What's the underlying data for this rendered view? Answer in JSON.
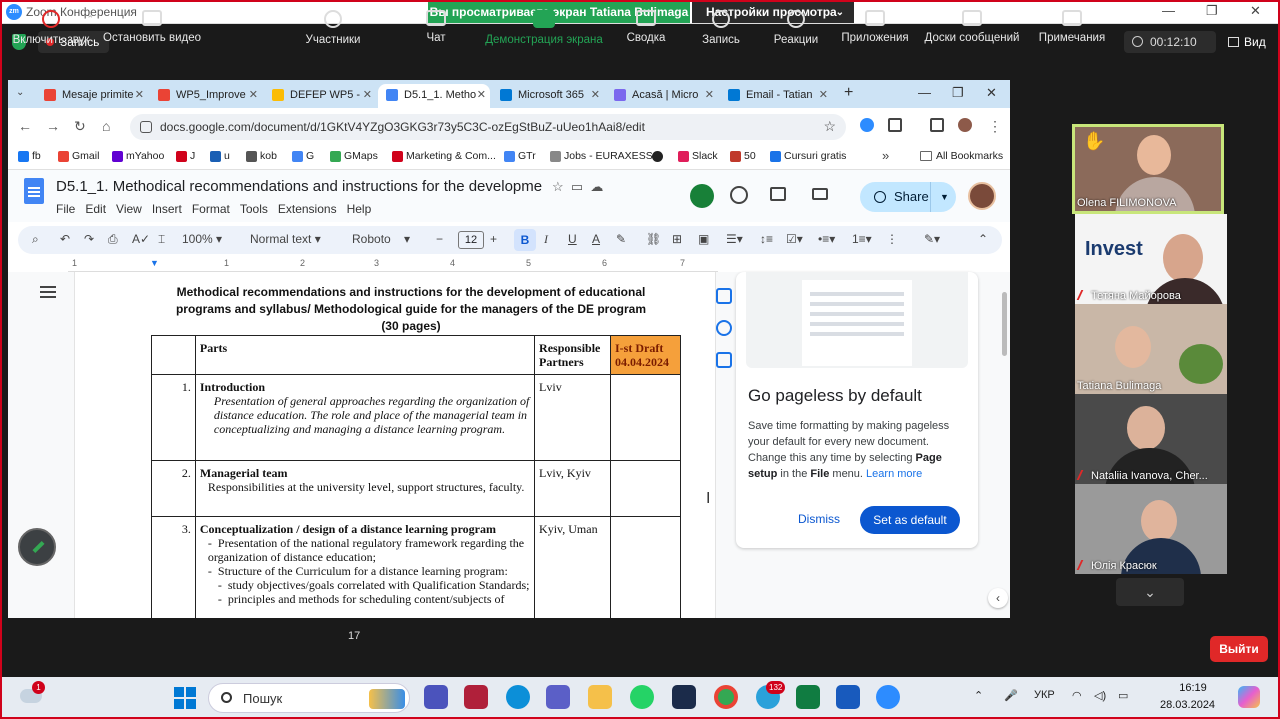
{
  "zoom": {
    "app_title": "Zoom Конференция",
    "viewing_banner": "Вы просматриваете экран Tatiana Bulimaga",
    "view_settings": "Настройки просмотра",
    "recording_label": "Запись",
    "timer": "00:12:10",
    "view_label": "Вид",
    "leave_label": "Выйти",
    "participants_count": "17",
    "toolbar": [
      {
        "name": "unmute",
        "label": "Включить звук"
      },
      {
        "name": "start-video",
        "label": "Остановить видео"
      },
      {
        "name": "participants",
        "label": "Участники"
      },
      {
        "name": "chat",
        "label": "Чат"
      },
      {
        "name": "share-screen",
        "label": "Демонстрация экрана"
      },
      {
        "name": "summary",
        "label": "Сводка"
      },
      {
        "name": "record",
        "label": "Запись"
      },
      {
        "name": "reactions",
        "label": "Реакции"
      },
      {
        "name": "apps",
        "label": "Приложения"
      },
      {
        "name": "whiteboards",
        "label": "Доски сообщений"
      },
      {
        "name": "notes",
        "label": "Примечания"
      }
    ],
    "participants": [
      {
        "name": "Olena FILIMONOVA",
        "muted": false
      },
      {
        "name": "Тетяна Майорова",
        "muted": true
      },
      {
        "name": "Tatiana Bulimaga",
        "muted": false
      },
      {
        "name": "Nataliia Ivanova, Cher...",
        "muted": true
      },
      {
        "name": "Юлія Красюк",
        "muted": true
      }
    ]
  },
  "chrome": {
    "tabs": [
      {
        "label": "Mesaje primite",
        "color": "#ea4335"
      },
      {
        "label": "WP5_Improve",
        "color": "#ea4335"
      },
      {
        "label": "DEFEP WP5 -",
        "color": "#fbbc04"
      },
      {
        "label": "D5.1_1. Metho",
        "color": "#4285f4"
      },
      {
        "label": "Microsoft 365",
        "color": "#0078d4"
      },
      {
        "label": "Acasă | Micro",
        "color": "#7b68ee"
      },
      {
        "label": "Email - Tatian",
        "color": "#0078d4"
      }
    ],
    "url": "docs.google.com/document/d/1GKtV4YZgO3GKG3r73y5C3C-ozEgStBuZ-uUeo1hAai8/edit",
    "bookmarks": [
      {
        "label": "fb",
        "color": "#1877f2"
      },
      {
        "label": "Gmail",
        "color": "#ea4335"
      },
      {
        "label": "mYahoo",
        "color": "#6001d2"
      },
      {
        "label": "J",
        "color": "#d0021b"
      },
      {
        "label": "u",
        "color": "#1a5fb4"
      },
      {
        "label": "kob",
        "color": "#555555"
      },
      {
        "label": "G",
        "color": "#4285f4"
      },
      {
        "label": "GMaps",
        "color": "#34a853"
      },
      {
        "label": "Marketing & Com...",
        "color": "#d0021b"
      },
      {
        "label": "GTr",
        "color": "#4285f4"
      },
      {
        "label": "Jobs - EURAXESS",
        "color": "#888888"
      },
      {
        "label": "",
        "color": "#222222"
      },
      {
        "label": "Slack",
        "color": "#e01e5a"
      },
      {
        "label": "50",
        "color": "#c0392b"
      },
      {
        "label": "Cursuri gratis",
        "color": "#1a73e8"
      }
    ],
    "all_bookmarks": "All Bookmarks"
  },
  "docs": {
    "title": "D5.1_1. Methodical recommendations and instructions for the developmen...",
    "menu": [
      "File",
      "Edit",
      "View",
      "Insert",
      "Format",
      "Tools",
      "Extensions",
      "Help"
    ],
    "share_label": "Share",
    "zoom": "100%",
    "style": "Normal text",
    "font": "Roboto",
    "font_size": "12",
    "ruler": [
      "1",
      "1",
      "2",
      "3",
      "4",
      "5",
      "6",
      "7"
    ],
    "page_title_lines": [
      "Methodical recommendations and instructions for the development of educational",
      "programs and syllabus/ Methodological guide for the managers of the DE program",
      "(30 pages)"
    ],
    "table": {
      "header": {
        "parts": "Parts",
        "partners": "Responsible Partners",
        "draft": "I-st Draft 04.04.2024"
      },
      "rows": [
        {
          "num": "1.",
          "title": "Introduction",
          "body": "Presentation of general approaches regarding the organization of distance education. The role and place of the managerial team in conceptualizing and managing a distance learning program.",
          "partners": "Lviv"
        },
        {
          "num": "2.",
          "title": "Managerial team",
          "body": "Responsibilities at the university level, support structures, faculty.",
          "partners": "Lviv, Kyiv"
        },
        {
          "num": "3.",
          "title": "Conceptualization / design of a distance learning program",
          "items": [
            "Presentation of the national regulatory framework regarding the organization of distance education;",
            "Structure of the Curriculum for a distance learning program:"
          ],
          "subitems": [
            "study objectives/goals correlated with Qualification Standards;",
            "principles and methods for scheduling content/subjects of"
          ],
          "partners": "Kyiv, Uman"
        }
      ]
    },
    "card": {
      "title": "Go pageless by default",
      "body_pre": "Save time formatting by making pageless your default for every new document. Change this any time by selecting",
      "body_b1": "Page setup",
      "body_mid": "in the",
      "body_b2": "File",
      "body_post": "menu.",
      "link": "Learn more",
      "dismiss": "Dismiss",
      "set_default": "Set as default"
    }
  },
  "taskbar": {
    "weather_badge": "1",
    "search_placeholder": "Пошук",
    "telegram_badge": "132",
    "language": "УКР",
    "time": "16:19",
    "date": "28.03.2024"
  }
}
